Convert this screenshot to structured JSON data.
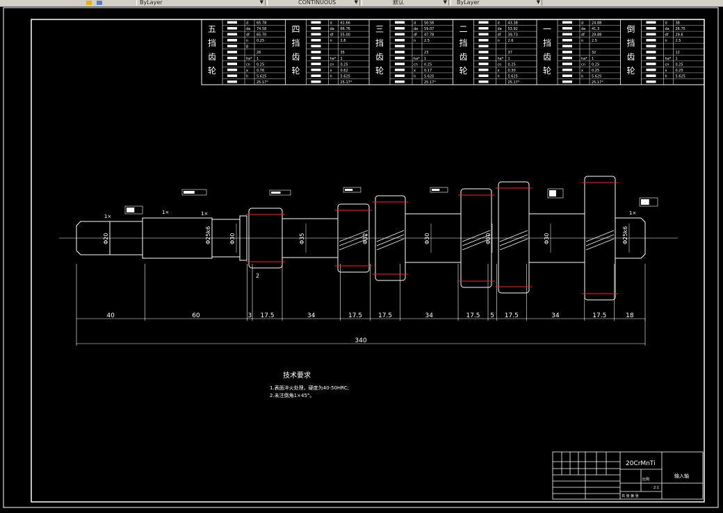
{
  "toolbar": {
    "linetype_value": "ByLayer",
    "color_value": "CONTINUOUS",
    "lineweight_value": "默认",
    "plotstyle_value": "ByLayer"
  },
  "gear_table": {
    "columns": [
      {
        "label": "五挡齿轮",
        "params": [
          [
            "d",
            "65.78"
          ],
          [
            "da",
            "74.58"
          ],
          [
            "df",
            "65.70"
          ],
          [
            "n",
            "0.25"
          ],
          [
            "β",
            ""
          ],
          [
            "",
            "26"
          ],
          [
            "ha*",
            "1"
          ],
          [
            "cn",
            "0.25"
          ],
          [
            "x",
            "0.76"
          ],
          [
            "h",
            "5.625"
          ],
          [
            "",
            "25.17°"
          ]
        ]
      },
      {
        "label": "四挡齿轮",
        "params": [
          [
            "d",
            "61.66"
          ],
          [
            "da",
            "66.76"
          ],
          [
            "df",
            "55.00"
          ],
          [
            "n",
            "2.8"
          ],
          [
            "",
            ""
          ],
          [
            "",
            "35"
          ],
          [
            "ha*",
            "1"
          ],
          [
            "cn",
            "0.25"
          ],
          [
            "x",
            "0.62"
          ],
          [
            "h",
            "5.625"
          ],
          [
            "",
            "25.17°"
          ]
        ]
      },
      {
        "label": "三挡齿轮",
        "params": [
          [
            "d",
            "50.56"
          ],
          [
            "da",
            "59.07"
          ],
          [
            "df",
            "47.78"
          ],
          [
            "n",
            "2.5"
          ],
          [
            "",
            ""
          ],
          [
            "",
            "23"
          ],
          [
            "ha*",
            "1"
          ],
          [
            "cn",
            "0.25"
          ],
          [
            "x",
            "0.17"
          ],
          [
            "h",
            "5.625"
          ],
          [
            "",
            "25.17°"
          ]
        ]
      },
      {
        "label": "二挡齿轮",
        "params": [
          [
            "d",
            "43.38"
          ],
          [
            "da",
            "53.92"
          ],
          [
            "df",
            "39.73"
          ],
          [
            "n",
            "2.6"
          ],
          [
            "",
            ""
          ],
          [
            "",
            "37"
          ],
          [
            "ha*",
            "1"
          ],
          [
            "cn",
            "0.25"
          ],
          [
            "x",
            "0.30"
          ],
          [
            "h",
            "5.625"
          ],
          [
            "",
            "25.17°"
          ]
        ]
      },
      {
        "label": "一挡齿轮",
        "params": [
          [
            "d",
            "24.88"
          ],
          [
            "da",
            "41.3"
          ],
          [
            "df",
            "29.88"
          ],
          [
            "n",
            "2.5"
          ],
          [
            "",
            ""
          ],
          [
            "",
            "32"
          ],
          [
            "ha*",
            "1"
          ],
          [
            "cn",
            "0.25"
          ],
          [
            "x",
            "0.25"
          ],
          [
            "h",
            "5.625"
          ],
          [
            "",
            "25.17°"
          ]
        ]
      },
      {
        "label": "倒挡齿轮",
        "params": [
          [
            "d",
            "38"
          ],
          [
            "da",
            "26.75"
          ],
          [
            "df",
            "29.6"
          ],
          [
            "n",
            "2.5"
          ],
          [
            "",
            ""
          ],
          [
            "",
            "12"
          ],
          [
            "ha*",
            "1"
          ],
          [
            "cn",
            "0.25"
          ],
          [
            "x",
            "0.25"
          ],
          [
            "h",
            "5.625"
          ],
          [
            "",
            ""
          ]
        ]
      }
    ]
  },
  "dimensions": {
    "segments": [
      "40",
      "60",
      "3",
      "17.5",
      "34",
      "17.5",
      "17.5",
      "34",
      "17.5",
      "5",
      "17.5",
      "34",
      "17.5",
      "18"
    ],
    "overall": "340",
    "gap_label": "2"
  },
  "diameters": [
    "Φ20",
    "Φ25k6",
    "Φ30",
    "Φ35",
    "Φ32",
    "Φ30",
    "Φ30",
    "Φ30",
    "Φ25k6"
  ],
  "chamfer_labels": [
    "1×",
    "1×",
    "1×",
    "1×"
  ],
  "tech_requirements": {
    "title": "技术要求",
    "items": [
      "1.表面淬火处理，硬度为40-50HRC;",
      "2.未注倒角1×45°。"
    ]
  },
  "title_block": {
    "material": "20CrMnTi",
    "part_name": "输入轴",
    "scale_label": "比例",
    "scale_value": "2:1",
    "sheet_info": "共  张  第  张"
  },
  "colors": {
    "background": "#000000",
    "line": "#ffffff",
    "highlight": "#ff2020"
  }
}
